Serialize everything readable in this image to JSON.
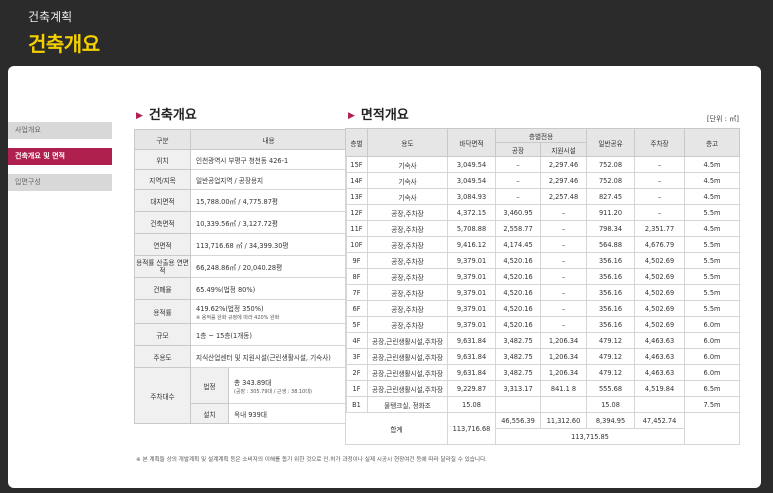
{
  "header": {
    "sub": "건축계획",
    "title": "건축개요"
  },
  "sidebar": [
    {
      "label": "사업개요",
      "active": false
    },
    {
      "label": "건축개요 및 면적",
      "active": true
    },
    {
      "label": "입면구성",
      "active": false
    }
  ],
  "overview": {
    "title": "건축개요",
    "col_headers": [
      "구분",
      "내용"
    ],
    "rows": [
      {
        "label": "위치",
        "value": "인천광역시 부평구 청천동 426-1"
      },
      {
        "label": "지역/지목",
        "value": "일반공업지역 / 공장용지"
      },
      {
        "label": "대지면적",
        "value": "15,788.00㎡ / 4,775.87평"
      },
      {
        "label": "건축면적",
        "value": "10,339.56㎡ / 3,127.72평"
      },
      {
        "label": "연면적",
        "value": "113,716.68 ㎡ / 34,399.30평"
      },
      {
        "label": "용적률 산출용 연면적",
        "value": "66,248.86㎡ / 20,040.28평"
      },
      {
        "label": "건폐율",
        "value": "65.49%(법정 80%)"
      },
      {
        "label": "용적률",
        "value": "419.62%(법정 350%)",
        "sub": "※ 용적률 완화 규정에 따라 420% 완화"
      },
      {
        "label": "규모",
        "value": "1층 ~ 15층(1개동)"
      },
      {
        "label": "주용도",
        "value": "지식산업센터 및 지원시설(근린생활시설, 기숙사)"
      }
    ],
    "parking": {
      "label": "주차대수",
      "legal_label": "법정",
      "legal_value": "총 343.89대",
      "legal_sub": "(공장 : 305.79대 / 근생 : 38.10대)",
      "built_label": "설치",
      "built_value": "옥내 939대"
    }
  },
  "area": {
    "title": "면적개요",
    "unit": "[단위 : ㎡]",
    "headers": {
      "floor": "층별",
      "use": "용도",
      "floor_area": "바닥면적",
      "exclusive": "층별전용",
      "factory": "공장",
      "support": "지원시설",
      "common": "일반공유",
      "parking": "주차장",
      "height": "층고"
    },
    "rows": [
      [
        "15F",
        "기숙사",
        "3,049.54",
        "–",
        "2,297.46",
        "752.08",
        "–",
        "4.5m"
      ],
      [
        "14F",
        "기숙사",
        "3,049.54",
        "–",
        "2,297.46",
        "752.08",
        "–",
        "4.5m"
      ],
      [
        "13F",
        "기숙사",
        "3,084.93",
        "–",
        "2,257.48",
        "827.45",
        "–",
        "4.5m"
      ],
      [
        "12F",
        "공장,주차장",
        "4,372.15",
        "3,460.95",
        "–",
        "911.20",
        "–",
        "5.5m"
      ],
      [
        "11F",
        "공장,주차장",
        "5,708.88",
        "2,558.77",
        "–",
        "798.34",
        "2,351.77",
        "4.5m"
      ],
      [
        "10F",
        "공장,주차장",
        "9,416.12",
        "4,174.45",
        "–",
        "564.88",
        "4,676.79",
        "5.5m"
      ],
      [
        "9F",
        "공장,주차장",
        "9,379.01",
        "4,520.16",
        "–",
        "356.16",
        "4,502.69",
        "5.5m"
      ],
      [
        "8F",
        "공장,주차장",
        "9,379.01",
        "4,520.16",
        "–",
        "356.16",
        "4,502.69",
        "5.5m"
      ],
      [
        "7F",
        "공장,주차장",
        "9,379.01",
        "4,520.16",
        "–",
        "356.16",
        "4,502.69",
        "5.5m"
      ],
      [
        "6F",
        "공장,주차장",
        "9,379.01",
        "4,520.16",
        "–",
        "356.16",
        "4,502.69",
        "5.5m"
      ],
      [
        "5F",
        "공장,주차장",
        "9,379.01",
        "4,520.16",
        "–",
        "356.16",
        "4,502.69",
        "6.0m"
      ],
      [
        "4F",
        "공장,근린생활시설,주차장",
        "9,631.84",
        "3,482.75",
        "1,206.34",
        "479.12",
        "4,463.63",
        "6.0m"
      ],
      [
        "3F",
        "공장,근린생활시설,주차장",
        "9,631.84",
        "3,482.75",
        "1,206.34",
        "479.12",
        "4,463.63",
        "6.0m"
      ],
      [
        "2F",
        "공장,근린생활시설,주차장",
        "9,631.84",
        "3,482.75",
        "1,206.34",
        "479.12",
        "4,463.63",
        "6.0m"
      ],
      [
        "1F",
        "공장,근린생활시설,주차장",
        "9,229.87",
        "3,313.17",
        "841.1 8",
        "555.68",
        "4,519.84",
        "6.5m"
      ],
      [
        "B1",
        "물탱크실, 정화조",
        "15.08",
        "",
        "",
        "15.08",
        "",
        "7.5m"
      ]
    ],
    "total": {
      "label": "합계",
      "floor_area": "113,716.68",
      "factory": "46,556.39",
      "support": "11,312.60",
      "common": "8,394.95",
      "parking": "47,452.74",
      "sum": "113,715.85"
    }
  },
  "note": "※ 본 계획들 상의 개발계획 및 설계계획 등은 소비자의 이해를 돕기 위한 것으로 인.허가 과정이나 실제 시공시 현장여건 등에 따라 달라질 수 있습니다."
}
